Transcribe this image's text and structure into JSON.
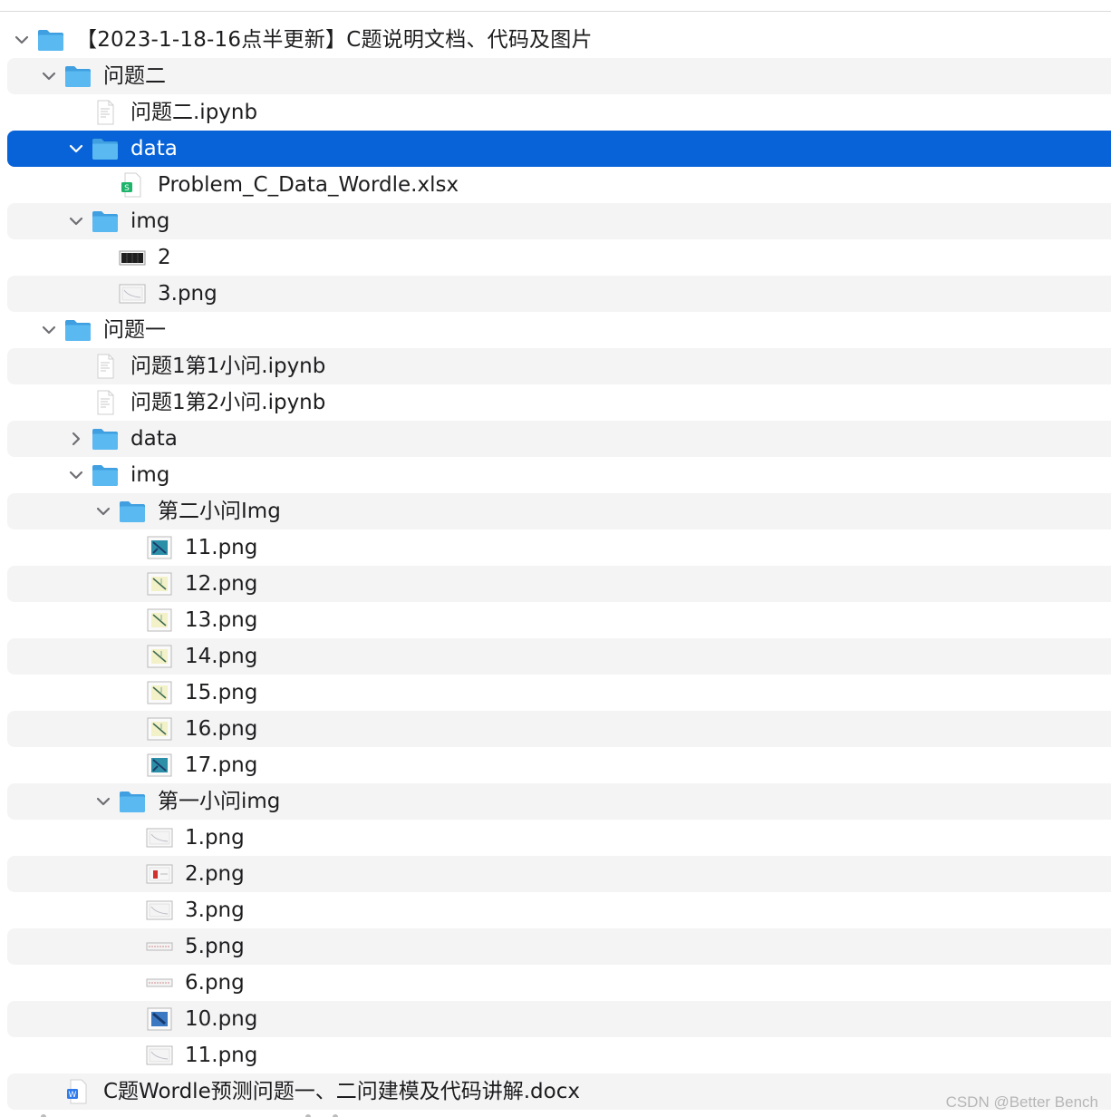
{
  "tree": [
    {
      "label": "【2023-1-18-16点半更新】C题说明文档、代码及图片",
      "depth": 0,
      "kind": "folder",
      "expanded": true,
      "root": true
    },
    {
      "label": "问题二",
      "depth": 1,
      "kind": "folder",
      "expanded": true
    },
    {
      "label": "问题二.ipynb",
      "depth": 2,
      "kind": "doc"
    },
    {
      "label": "data",
      "depth": 2,
      "kind": "folder",
      "expanded": true,
      "selected": true
    },
    {
      "label": "Problem_C_Data_Wordle.xlsx",
      "depth": 3,
      "kind": "xlsx"
    },
    {
      "label": "img",
      "depth": 2,
      "kind": "folder",
      "expanded": true
    },
    {
      "label": "2",
      "depth": 3,
      "kind": "img-dark"
    },
    {
      "label": "3.png",
      "depth": 3,
      "kind": "img-light"
    },
    {
      "label": "问题一",
      "depth": 1,
      "kind": "folder",
      "expanded": true
    },
    {
      "label": "问题1第1小问.ipynb",
      "depth": 2,
      "kind": "doc"
    },
    {
      "label": "问题1第2小问.ipynb",
      "depth": 2,
      "kind": "doc"
    },
    {
      "label": "data",
      "depth": 2,
      "kind": "folder",
      "expanded": false
    },
    {
      "label": "img",
      "depth": 2,
      "kind": "folder",
      "expanded": true
    },
    {
      "label": "第二小问Img",
      "depth": 3,
      "kind": "folder",
      "expanded": true
    },
    {
      "label": "11.png",
      "depth": 4,
      "kind": "img-teal"
    },
    {
      "label": "12.png",
      "depth": 4,
      "kind": "img-yellow"
    },
    {
      "label": "13.png",
      "depth": 4,
      "kind": "img-yellow"
    },
    {
      "label": "14.png",
      "depth": 4,
      "kind": "img-yellow"
    },
    {
      "label": "15.png",
      "depth": 4,
      "kind": "img-yellow"
    },
    {
      "label": "16.png",
      "depth": 4,
      "kind": "img-yellow"
    },
    {
      "label": "17.png",
      "depth": 4,
      "kind": "img-teal"
    },
    {
      "label": "第一小问img",
      "depth": 3,
      "kind": "folder",
      "expanded": true
    },
    {
      "label": "1.png",
      "depth": 4,
      "kind": "img-light"
    },
    {
      "label": "2.png",
      "depth": 4,
      "kind": "img-red"
    },
    {
      "label": "3.png",
      "depth": 4,
      "kind": "img-light"
    },
    {
      "label": "5.png",
      "depth": 4,
      "kind": "img-wide"
    },
    {
      "label": "6.png",
      "depth": 4,
      "kind": "img-wide"
    },
    {
      "label": "10.png",
      "depth": 4,
      "kind": "img-blue"
    },
    {
      "label": "11.png",
      "depth": 4,
      "kind": "img-light"
    },
    {
      "label": "C题Wordle预测问题一、二问建模及代码讲解.docx",
      "depth": 1,
      "kind": "word"
    }
  ],
  "watermark": "CSDN @Better Bench",
  "colors": {
    "selection": "#0863d8",
    "folder": "#5ab9f1",
    "stripe": "#f4f4f5"
  }
}
